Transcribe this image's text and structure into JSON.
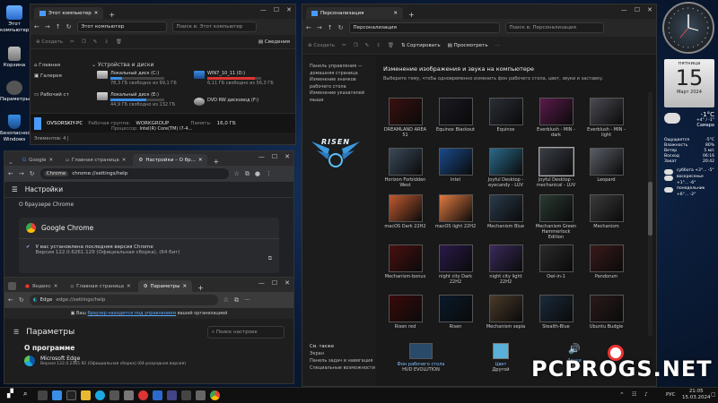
{
  "desktop": {
    "icons": [
      {
        "label": "Этот компьютер"
      },
      {
        "label": "Корзина"
      },
      {
        "label": "Параметры"
      },
      {
        "label": "Безопасность Windows"
      }
    ]
  },
  "explorer": {
    "tab_title": "Этот компьютер",
    "address": "Этот компьютер",
    "search_placeholder": "Поиск в: Этот компьютер",
    "create_label": "Создать",
    "details_label": "Сведения",
    "nav": [
      "Главная",
      "Галерея",
      "Рабочий ст"
    ],
    "section_label": "Устройства и диски",
    "drives": [
      {
        "name": "Локальный диск (C:)",
        "free": "78,3 ГБ свободно из 99,1 ГБ",
        "used_fraction": 0.21
      },
      {
        "name": "WIN7_10_11 (D:)",
        "free": "6,11 ГБ свободно из 56,3 ГБ",
        "used_fraction": 0.89
      },
      {
        "name": "Локальный диск (E:)",
        "free": "44,9 ГБ свободно из 132 ГБ",
        "used_fraction": 0.66
      },
      {
        "name": "DVD RW дисковод (F:)",
        "free": "",
        "used_fraction": 0
      }
    ],
    "pc_name": "OVSORSKIY-PC",
    "workgroup_label": "Рабочая группа:",
    "workgroup": "WORKGROUP",
    "memory_label": "Память:",
    "memory": "16,0 ГБ",
    "processor_label": "Процессор:",
    "processor": "Intel(R) Core(TM) i7-4...",
    "status": "Элементов: 4 |"
  },
  "personalization": {
    "tab_title": "Персонализация",
    "address": "Персонализация",
    "search_placeholder": "Поиск в: Персонализация",
    "create_label": "Создать",
    "sort_label": "Сортировать",
    "view_label": "Просмотреть",
    "nav_links": [
      "Панель управления — домашняя страница",
      "Изменение значков рабочего стола",
      "Изменение указателей мыши"
    ],
    "logo": "RISEN",
    "heading": "Изменение изображения и звука на компьютере",
    "subheading": "Выберите тему, чтобы одновременно изменить фон рабочего стола, цвет, звуки и заставку.",
    "see_also_title": "См. также",
    "see_also": [
      "Экран",
      "Панель задач и навигация",
      "Специальные возможности"
    ],
    "themes": [
      {
        "name": "DREAMLAND AREA 51",
        "color": "#3a1010"
      },
      {
        "name": "Equinox Blackout",
        "color": "#1a1a22"
      },
      {
        "name": "Equinox",
        "color": "#2a2e36"
      },
      {
        "name": "Everblush - MIN - dark",
        "color": "#5a1a4a"
      },
      {
        "name": "Everblush - MIN - light",
        "color": "#4a4a52"
      },
      {
        "name": "Horizon Forbidden West",
        "color": "#3a4a5a"
      },
      {
        "name": "Intel",
        "color": "#1a4a8a"
      },
      {
        "name": "Joyful Desktop - eyecandy - LUV",
        "color": "#2a6a8a"
      },
      {
        "name": "Joyful Desktop - mechanical - LUV",
        "color": "#3a3e46"
      },
      {
        "name": "Leopard",
        "color": "#5a5e66"
      },
      {
        "name": "macOS Dark 22H2",
        "color": "#c05a30"
      },
      {
        "name": "macOS light 22H2",
        "color": "#e07a40"
      },
      {
        "name": "Mechanism Blue",
        "color": "#2a3a4a"
      },
      {
        "name": "Mechanism Green Hammerlock Edition",
        "color": "#2a3a32"
      },
      {
        "name": "Mechanism",
        "color": "#3a3a3a"
      },
      {
        "name": "Mechanism-bonus",
        "color": "#4a1010"
      },
      {
        "name": "night city Dark 22H2",
        "color": "#2a1a4a"
      },
      {
        "name": "night city light 22H2",
        "color": "#3a2a5a"
      },
      {
        "name": "Owl-in-1",
        "color": "#2a2a2a"
      },
      {
        "name": "Pandorum",
        "color": "#3a1a1a"
      },
      {
        "name": "Risen red",
        "color": "#3a0a0a"
      },
      {
        "name": "Risen",
        "color": "#0a1a2a"
      },
      {
        "name": "Mechanism sepia",
        "color": "#4a3a2a"
      },
      {
        "name": "Stealth-Blue",
        "color": "#1a2a3a"
      },
      {
        "name": "Ubuntu Budgie",
        "color": "#2a1a1a"
      }
    ],
    "footer": [
      {
        "label": "Фон рабочего стола",
        "value": "HUD EVOLUTION"
      },
      {
        "label": "Цвет",
        "value": "Другой"
      },
      {
        "label": "Звуки",
        "value": "Risen"
      }
    ]
  },
  "chrome": {
    "tabs": [
      "Google",
      "Главная страница",
      "Настройки – О бр..."
    ],
    "site_label": "Chrome",
    "address": "chrome://settings/help",
    "settings_title": "Настройки",
    "section": "О браузере Chrome",
    "product": "Google Chrome",
    "status": "У вас установлена последняя версия Chrome",
    "version": "Версия 122.0.6261.129 (Официальная сборка), (64 бит)"
  },
  "edge": {
    "tabs": [
      "Яндекс",
      "Главная страница",
      "Параметры"
    ],
    "site_label": "Edge",
    "address": "edge://settings/help",
    "managed_prefix": "Ваш",
    "managed_link": "браузер находится под управлением",
    "managed_suffix": "вашей организацией",
    "settings_title": "Параметры",
    "search_placeholder": "Поиск настроек",
    "section": "О программе",
    "product": "Microsoft Edge",
    "version": "Версия 122.0.2365.92 (Официальная сборка) (64-разрядная версия)"
  },
  "gadgets": {
    "weekday": "пятница",
    "day": "15",
    "month_year": "Март 2024",
    "temp": "-1°C",
    "temp_range": "+4° / -1°",
    "city": "Самара",
    "weather": [
      {
        "label": "Ощущается",
        "value": "-5°C"
      },
      {
        "label": "Влажность",
        "value": "80%"
      },
      {
        "label": "Ветер",
        "value": "5 м/с"
      },
      {
        "label": "Восход",
        "value": "06:16"
      },
      {
        "label": "Закат",
        "value": "20:42"
      }
    ],
    "forecast": [
      {
        "day": "суббота",
        "range": "+3°... -5°"
      },
      {
        "day": "воскресенье",
        "range": "+1°... -6°"
      },
      {
        "day": "понедельник",
        "range": "+6°... -2°"
      }
    ]
  },
  "watermark": "PCPROGS.NET",
  "taskbar": {
    "lang": "РУС",
    "time": "21:05",
    "date": "15.03.2024"
  }
}
